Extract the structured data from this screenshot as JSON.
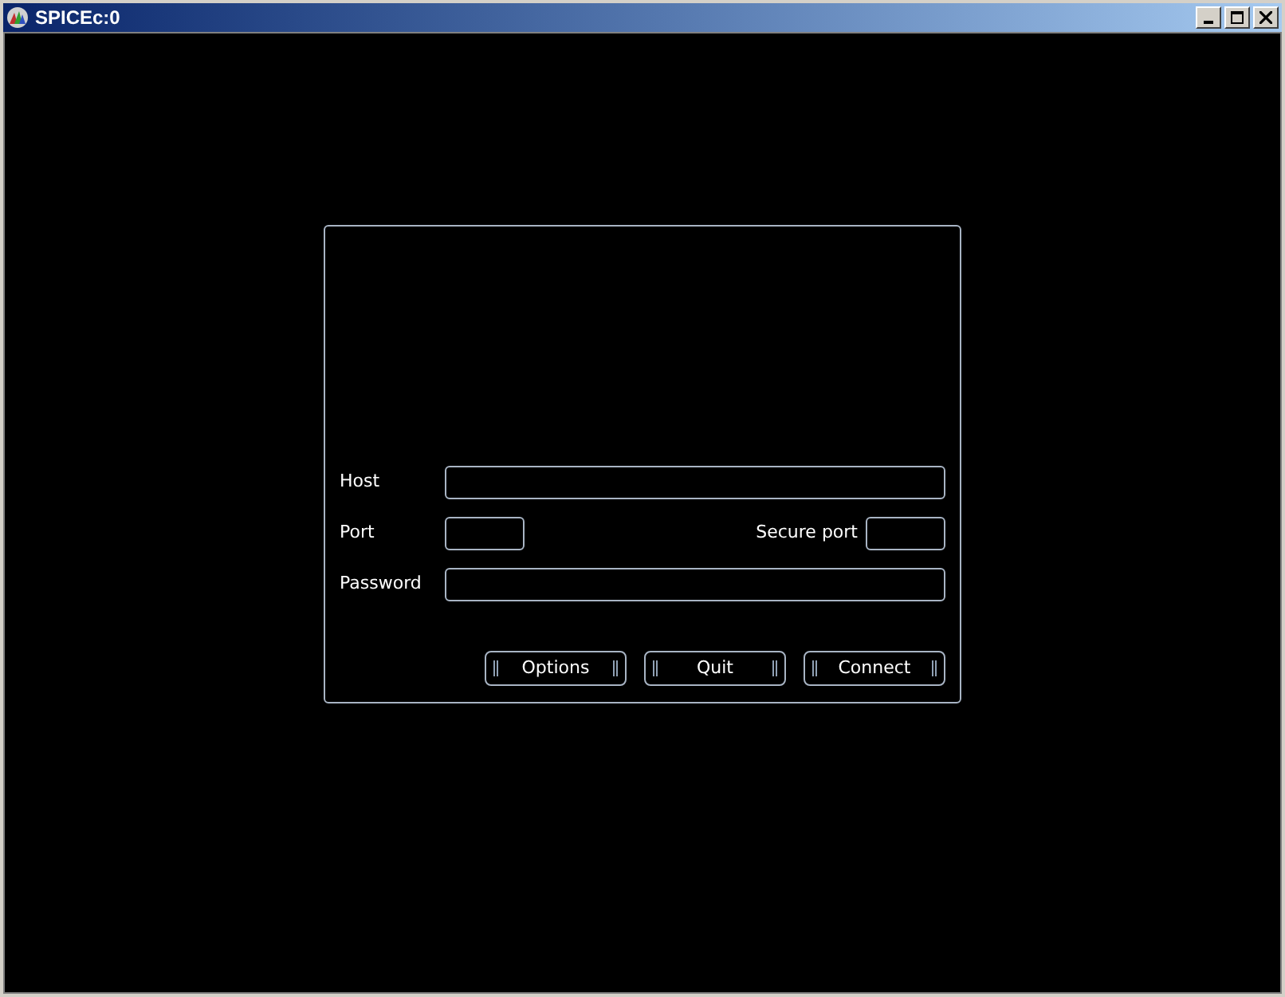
{
  "window": {
    "title": "SPICEc:0"
  },
  "form": {
    "host": {
      "label": "Host"
    },
    "port": {
      "label": "Port"
    },
    "secure_port": {
      "label": "Secure port"
    },
    "password": {
      "label": "Password"
    }
  },
  "buttons": [
    "Options",
    "Quit",
    "Connect"
  ]
}
